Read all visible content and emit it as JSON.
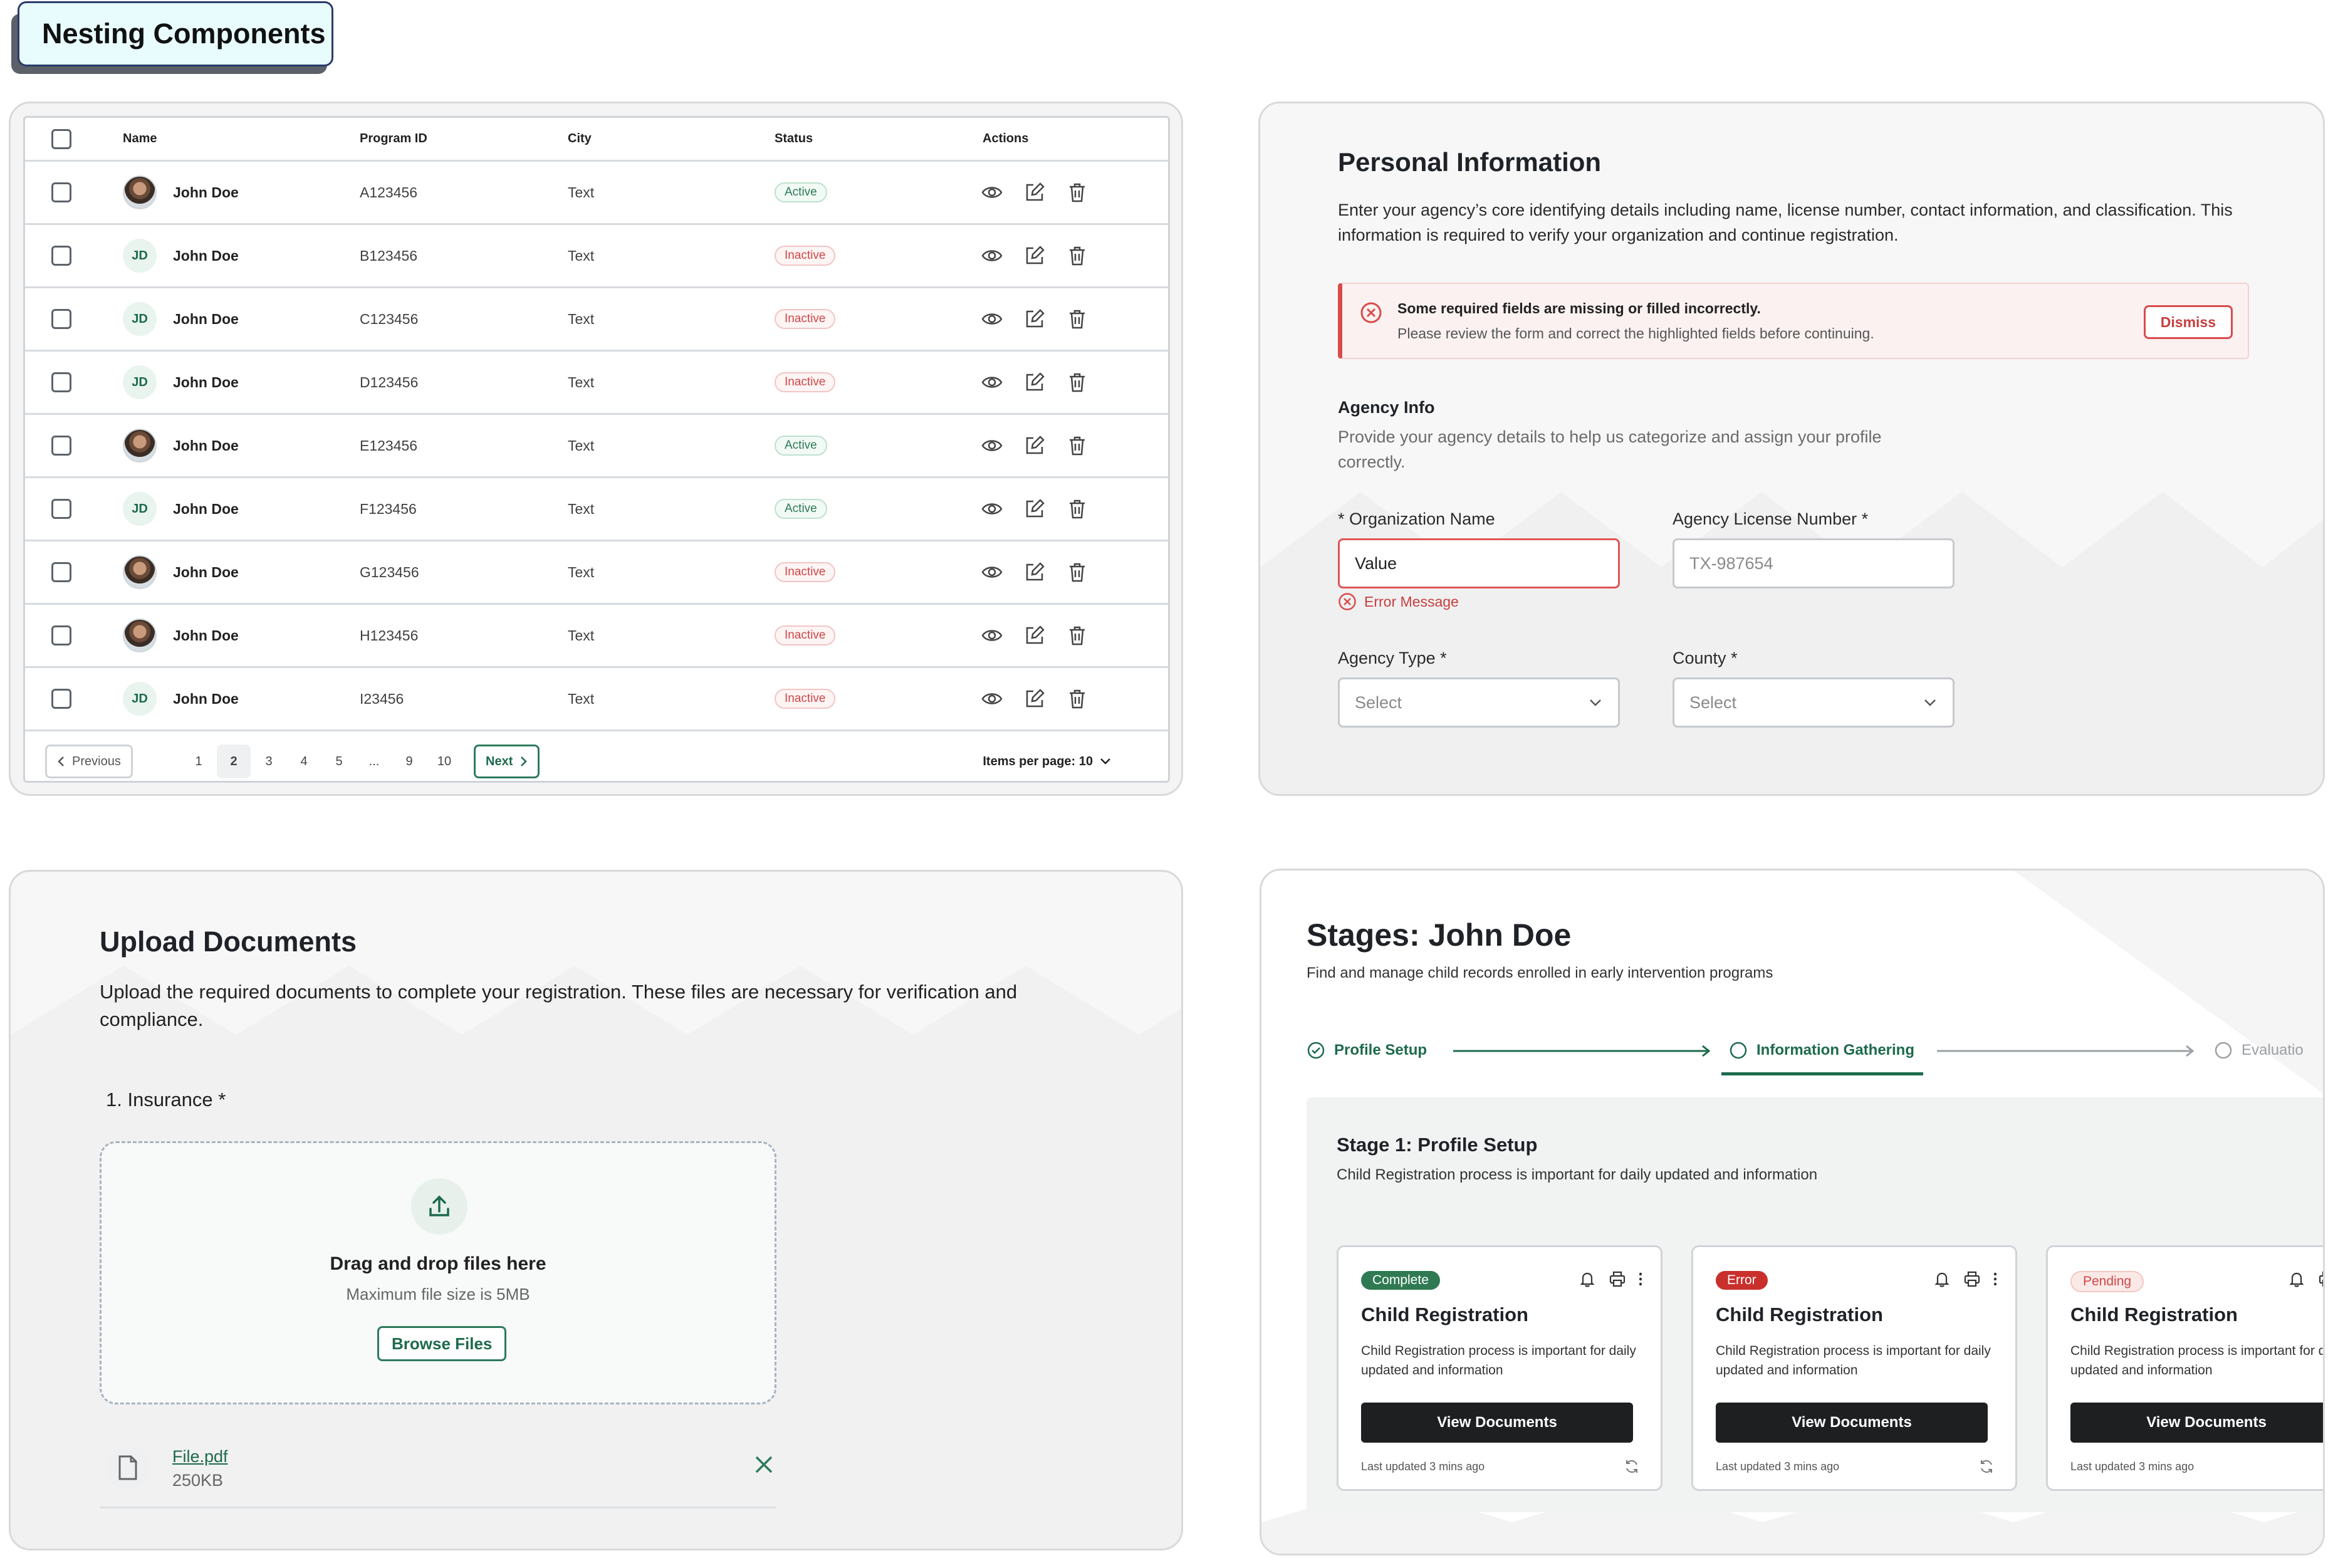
{
  "page_title": "Nesting Components",
  "table": {
    "columns": [
      "Name",
      "Program ID",
      "City",
      "Status",
      "Actions"
    ],
    "rows": [
      {
        "name": "John Doe",
        "avatar": "photo",
        "initials": "",
        "program_id": "A123456",
        "city": "Text",
        "status": "Active"
      },
      {
        "name": "John Doe",
        "avatar": "initials",
        "initials": "JD",
        "program_id": "B123456",
        "city": "Text",
        "status": "Inactive"
      },
      {
        "name": "John Doe",
        "avatar": "initials",
        "initials": "JD",
        "program_id": "C123456",
        "city": "Text",
        "status": "Inactive"
      },
      {
        "name": "John Doe",
        "avatar": "initials",
        "initials": "JD",
        "program_id": "D123456",
        "city": "Text",
        "status": "Inactive"
      },
      {
        "name": "John Doe",
        "avatar": "photo",
        "initials": "",
        "program_id": "E123456",
        "city": "Text",
        "status": "Active"
      },
      {
        "name": "John Doe",
        "avatar": "initials",
        "initials": "JD",
        "program_id": "F123456",
        "city": "Text",
        "status": "Active"
      },
      {
        "name": "John Doe",
        "avatar": "photo",
        "initials": "",
        "program_id": "G123456",
        "city": "Text",
        "status": "Inactive"
      },
      {
        "name": "John Doe",
        "avatar": "photo",
        "initials": "",
        "program_id": "H123456",
        "city": "Text",
        "status": "Inactive"
      },
      {
        "name": "John Doe",
        "avatar": "initials",
        "initials": "JD",
        "program_id": "I23456",
        "city": "Text",
        "status": "Inactive"
      }
    ],
    "action_icons": [
      "eye-icon",
      "edit-icon",
      "trash-icon"
    ],
    "pagination": {
      "previous_label": "Previous",
      "next_label": "Next",
      "pages": [
        "1",
        "2",
        "3",
        "4",
        "5",
        "...",
        "9",
        "10"
      ],
      "current_page": "2",
      "items_per_page_label": "Items per page: 10"
    }
  },
  "form": {
    "title": "Personal Information",
    "description": "Enter your agency’s core identifying details including name, license number, contact information, and classification. This information is required to verify your organization and continue registration.",
    "alert": {
      "title": "Some required fields are missing or filled incorrectly.",
      "message": "Please review the form and correct the highlighted fields before continuing.",
      "dismiss_label": "Dismiss"
    },
    "section_title": "Agency Info",
    "section_description": "Provide your agency details to help us categorize and assign your profile correctly.",
    "fields": {
      "org_name": {
        "label": "* Organization Name",
        "value": "Value",
        "error": "Error Message"
      },
      "license": {
        "label": "Agency License Number *",
        "placeholder": "TX-987654"
      },
      "agency_type": {
        "label": "Agency Type *",
        "value": "Select"
      },
      "county": {
        "label": "County *",
        "value": "Select"
      }
    }
  },
  "upload": {
    "title": "Upload Documents",
    "description": "Upload the required documents to complete your registration. These files are necessary for verification and compliance.",
    "field_label": "1. Insurance *",
    "dropzone_title": "Drag and drop files here",
    "dropzone_hint": "Maximum file size is 5MB",
    "browse_label": "Browse Files",
    "file": {
      "name": "File.pdf",
      "size": "250KB"
    }
  },
  "stages": {
    "title": "Stages: John Doe",
    "description": "Find and manage child records enrolled in early intervention programs",
    "steps": [
      {
        "label": "Profile Setup",
        "state": "done"
      },
      {
        "label": "Information Gathering",
        "state": "current"
      },
      {
        "label": "Evaluatio",
        "state": "todo"
      }
    ],
    "stage_title": "Stage 1: Profile Setup",
    "stage_description": "Child Registration process is important for daily updated and information",
    "cards": [
      {
        "badge": "Complete",
        "title": "Child Registration",
        "description": "Child Registration process is important for daily updated and information",
        "button": "View Documents",
        "footer": "Last updated 3 mins ago"
      },
      {
        "badge": "Error",
        "title": "Child Registration",
        "description": "Child Registration process is important for daily updated and information",
        "button": "View Documents",
        "footer": "Last updated 3 mins ago"
      },
      {
        "badge": "Pending",
        "title": "Child Registration",
        "description": "Child Registration process is important for daily updated and information",
        "button": "View Documents",
        "footer": "Last updated 3 mins ago"
      }
    ]
  },
  "colors": {
    "accent": "#1d6a4c",
    "error": "#d94b4b",
    "active_badge": "#2b7a57",
    "inactive_badge": "#d24646"
  }
}
